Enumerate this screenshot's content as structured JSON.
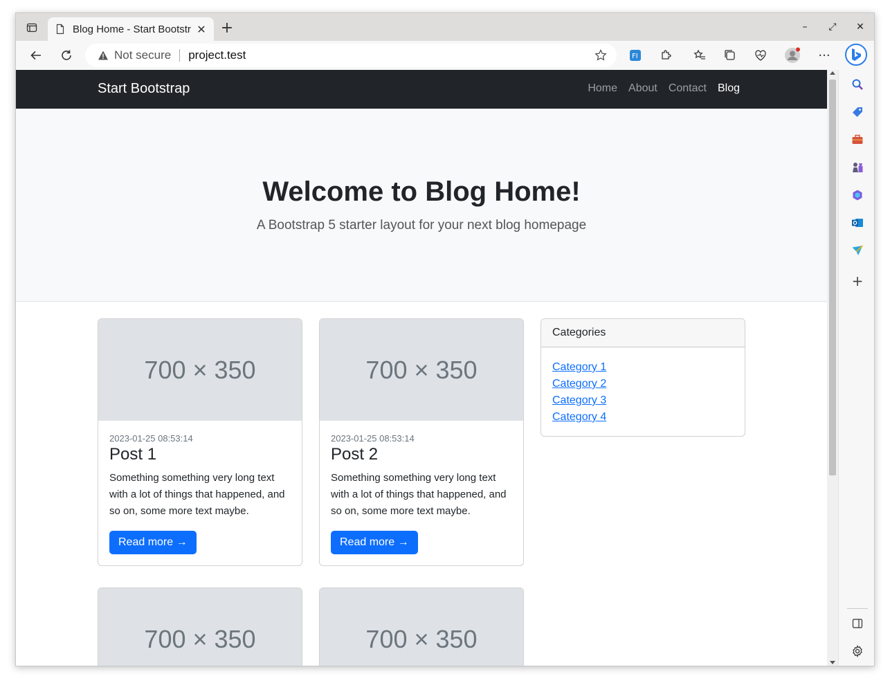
{
  "browser": {
    "tab_title": "Blog Home - Start Bootstr",
    "security_label": "Not secure",
    "url": "project.test"
  },
  "site": {
    "brand": "Start Bootstrap",
    "nav": [
      {
        "label": "Home",
        "active": false
      },
      {
        "label": "About",
        "active": false
      },
      {
        "label": "Contact",
        "active": false
      },
      {
        "label": "Blog",
        "active": true
      }
    ]
  },
  "hero": {
    "title": "Welcome to Blog Home!",
    "subtitle": "A Bootstrap 5 starter layout for your next blog homepage"
  },
  "posts": [
    {
      "image_text": "700 × 350",
      "date": "2023-01-25 08:53:14",
      "title": "Post 1",
      "excerpt": "Something something very long text with a lot of things that happened, and so on, some more text maybe.",
      "button": "Read more →"
    },
    {
      "image_text": "700 × 350",
      "date": "2023-01-25 08:53:14",
      "title": "Post 2",
      "excerpt": "Something something very long text with a lot of things that happened, and so on, some more text maybe.",
      "button": "Read more →"
    },
    {
      "image_text": "700 × 350"
    },
    {
      "image_text": "700 × 350"
    }
  ],
  "categories": {
    "header": "Categories",
    "items": [
      "Category 1",
      "Category 2",
      "Category 3",
      "Category 4"
    ]
  },
  "colors": {
    "navbar": "#212529",
    "primary": "#0d6efd",
    "hero_bg": "#f8f9fa",
    "placeholder_bg": "#dee2e6"
  }
}
